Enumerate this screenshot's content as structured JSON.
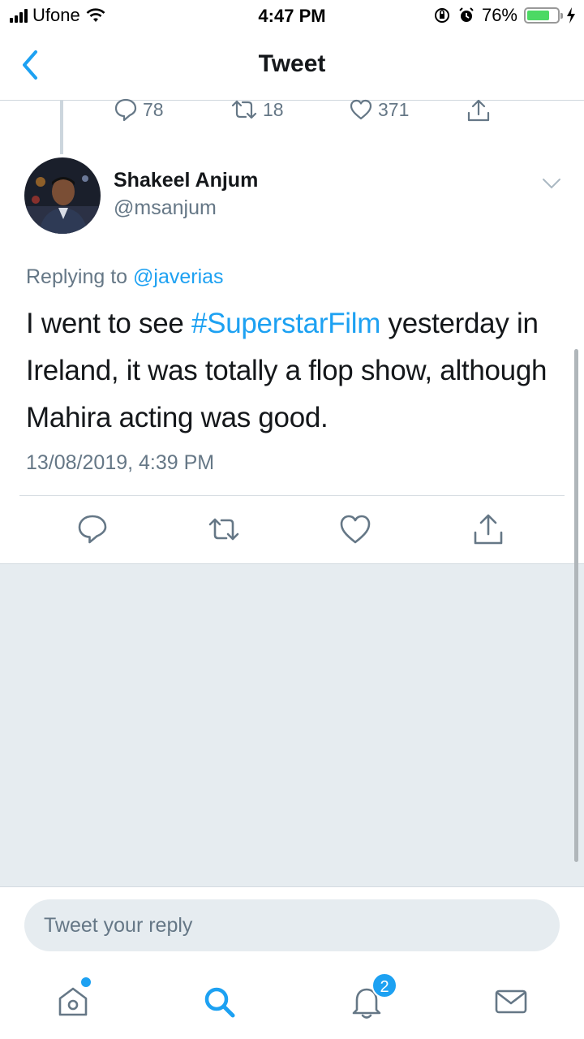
{
  "status_bar": {
    "carrier": "Ufone",
    "time": "4:47 PM",
    "battery_percent": "76%",
    "battery_level": 0.76
  },
  "nav": {
    "title": "Tweet",
    "back_icon": "chevron-left-icon"
  },
  "parent_tweet_stats": {
    "replies": "78",
    "retweets": "18",
    "likes": "371"
  },
  "tweet": {
    "author_name": "Shakeel Anjum",
    "author_handle": "@msanjum",
    "replying_prefix": "Replying to",
    "replying_to": "@javerias",
    "text_before": "I went to see ",
    "hashtag": "#SuperstarFilm",
    "text_after": " yesterday in Ireland, it was totally a flop show, although Mahira acting was good.",
    "timestamp": "13/08/2019, 4:39 PM"
  },
  "reply": {
    "placeholder": "Tweet your reply"
  },
  "tabbar": {
    "notifications_count": "2"
  },
  "colors": {
    "accent": "#1da1f2",
    "muted": "#657786",
    "background_gray": "#e6ecf0"
  }
}
